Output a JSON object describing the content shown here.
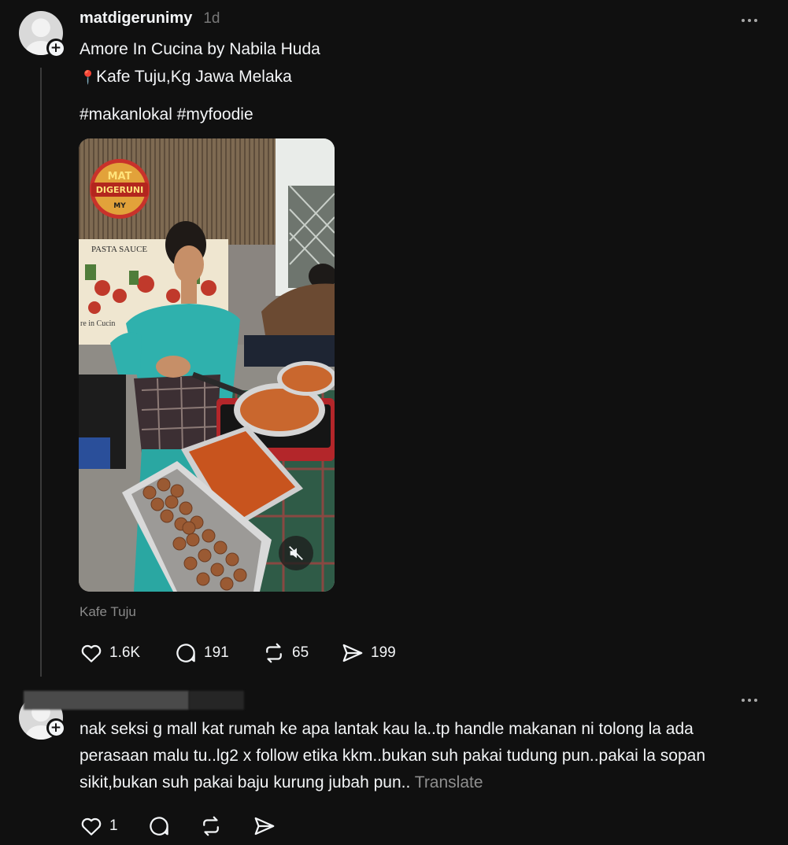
{
  "post": {
    "username": "matdigerunimy",
    "time": "1d",
    "line1": "Amore In Cucina by Nabila Huda",
    "line2_pin": "📍",
    "line2": "Kafe Tuju,Kg Jawa Melaka",
    "hashtags": "#makanlokal #myfoodie",
    "video_signage": {
      "logo_top": "MAT",
      "logo_mid": "DIGERUNI",
      "logo_bot": "MY",
      "sign1": "PASTA SAUCE",
      "sign2": "re in Cucin"
    },
    "location_caption": "Kafe Tuju",
    "stats": {
      "likes": "1.6K",
      "replies": "191",
      "reposts": "65",
      "shares": "199"
    }
  },
  "reply": {
    "text": "nak seksi g mall kat rumah ke apa lantak kau la..tp handle makanan ni tolong la ada perasaan malu tu..lg2 x follow etika kkm..bukan suh pakai tudung pun..pakai la sopan sikit,bukan suh pakai baju kurung jubah pun..",
    "translate_label": "Translate",
    "likes": "1"
  },
  "icons": {
    "more": "more-horizontal-icon",
    "heart": "heart-icon",
    "comment": "comment-icon",
    "repost": "repost-icon",
    "share": "send-icon",
    "mute": "speaker-muted-icon",
    "follow": "plus-icon"
  },
  "colors": {
    "background": "#101010",
    "text": "#f3f5f7",
    "muted": "#777777"
  }
}
